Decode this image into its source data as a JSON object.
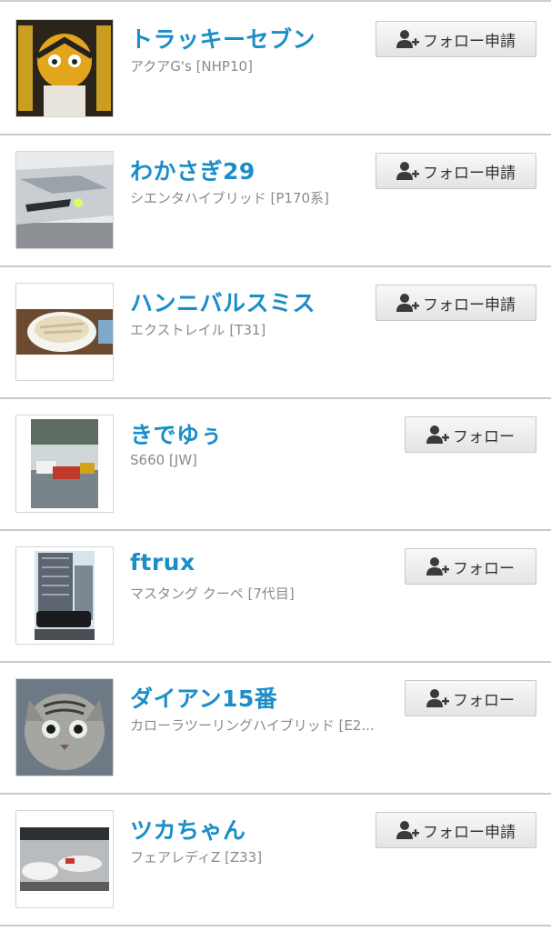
{
  "follow_list": {
    "items": [
      {
        "user_name": "トラッキーセブン",
        "car": "アクアG's [NHP10]",
        "button_label": "フォロー申請",
        "button_kind": "request"
      },
      {
        "user_name": "わかさぎ29",
        "car": "シエンタハイブリッド [P170系]",
        "button_label": "フォロー申請",
        "button_kind": "request"
      },
      {
        "user_name": "ハンニバルスミス",
        "car": "エクストレイル [T31]",
        "button_label": "フォロー申請",
        "button_kind": "request"
      },
      {
        "user_name": "きでゆぅ",
        "car": "S660 [JW]",
        "button_label": "フォロー",
        "button_kind": "follow"
      },
      {
        "user_name": "ftrux",
        "car": "マスタング クーペ [7代目]",
        "button_label": "フォロー",
        "button_kind": "follow"
      },
      {
        "user_name": "ダイアン15番",
        "car": "カローラツーリングハイブリッド [E2...",
        "button_label": "フォロー",
        "button_kind": "follow"
      },
      {
        "user_name": "ツカちゃん",
        "car": "フェアレディZ [Z33]",
        "button_label": "フォロー申請",
        "button_kind": "request"
      }
    ],
    "button_icon": "user-plus-icon",
    "colors": {
      "name_link": "#1a8ec8",
      "car_text": "#8a8a8a",
      "divider": "#c9c9c9"
    }
  }
}
